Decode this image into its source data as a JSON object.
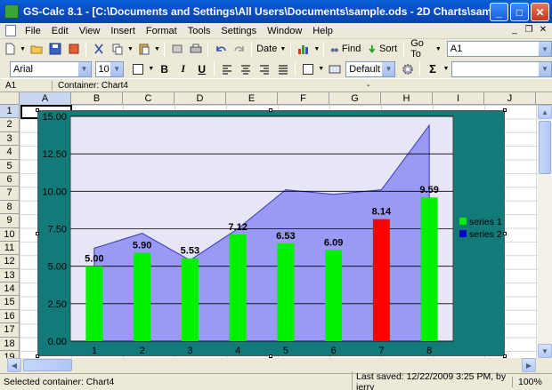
{
  "window": {
    "title": "GS-Calc 8.1 - [C:\\Documents and Settings\\All Users\\Documents\\sample.ods - 2D Charts\\sample3 *]",
    "minimize": "_",
    "maximize": "□",
    "close": "✕"
  },
  "menu": [
    "File",
    "Edit",
    "View",
    "Insert",
    "Format",
    "Tools",
    "Settings",
    "Window",
    "Help"
  ],
  "mdi_controls": [
    "_",
    "❐",
    "✕"
  ],
  "toolbar1": {
    "date_label": "Date",
    "find_label": "Find",
    "sort_label": "Sort",
    "goto_label": "Go To",
    "cellref_value": "A1"
  },
  "toolbar2": {
    "font_value": "Arial",
    "size_value": "10",
    "bold": "B",
    "italic": "I",
    "underline": "U",
    "style_value": "Default",
    "sigma": "Σ"
  },
  "cellrow": {
    "cell": "A1",
    "container": "Container: Chart4",
    "dash": "-"
  },
  "columns": [
    "A",
    "B",
    "C",
    "D",
    "E",
    "F",
    "G",
    "H",
    "I",
    "J"
  ],
  "rows": [
    "1",
    "2",
    "3",
    "4",
    "5",
    "6",
    "7",
    "8",
    "9",
    "10",
    "11",
    "12",
    "13",
    "14",
    "15",
    "16",
    "17",
    "18",
    "19"
  ],
  "colors": {
    "chart_bg": "#127a78",
    "plot_bg": "#e6e6f6",
    "area": "#9a9af6",
    "bar": "#00f000",
    "bar_highlight": "#ff0000",
    "series2": "#0000c0"
  },
  "chart_data": {
    "type": "bar",
    "categories": [
      "1",
      "2",
      "3",
      "4",
      "5",
      "6",
      "7",
      "8"
    ],
    "series": [
      {
        "name": "series 1",
        "type": "bar",
        "values": [
          5.0,
          5.9,
          5.53,
          7.12,
          6.53,
          6.09,
          8.14,
          9.59
        ],
        "labels": [
          "5.00",
          "5.90",
          "5.53",
          "7.12",
          "6.53",
          "6.09",
          "8.14",
          "9.59"
        ],
        "highlight_index": 6
      },
      {
        "name": "series 2",
        "type": "area",
        "values": [
          6.2,
          7.2,
          5.4,
          7.5,
          10.1,
          9.8,
          10.1,
          14.4
        ]
      }
    ],
    "ylim": [
      0,
      15
    ],
    "yticks": [
      "0.00",
      "2.50",
      "5.00",
      "7.50",
      "10.00",
      "12.50",
      "15.00"
    ],
    "grid": true,
    "legend": "right"
  },
  "status": {
    "left": "Selected container: Chart4",
    "saved": "Last saved: 12/22/2009 3:25 PM, by jerry",
    "zoom": "100%"
  }
}
